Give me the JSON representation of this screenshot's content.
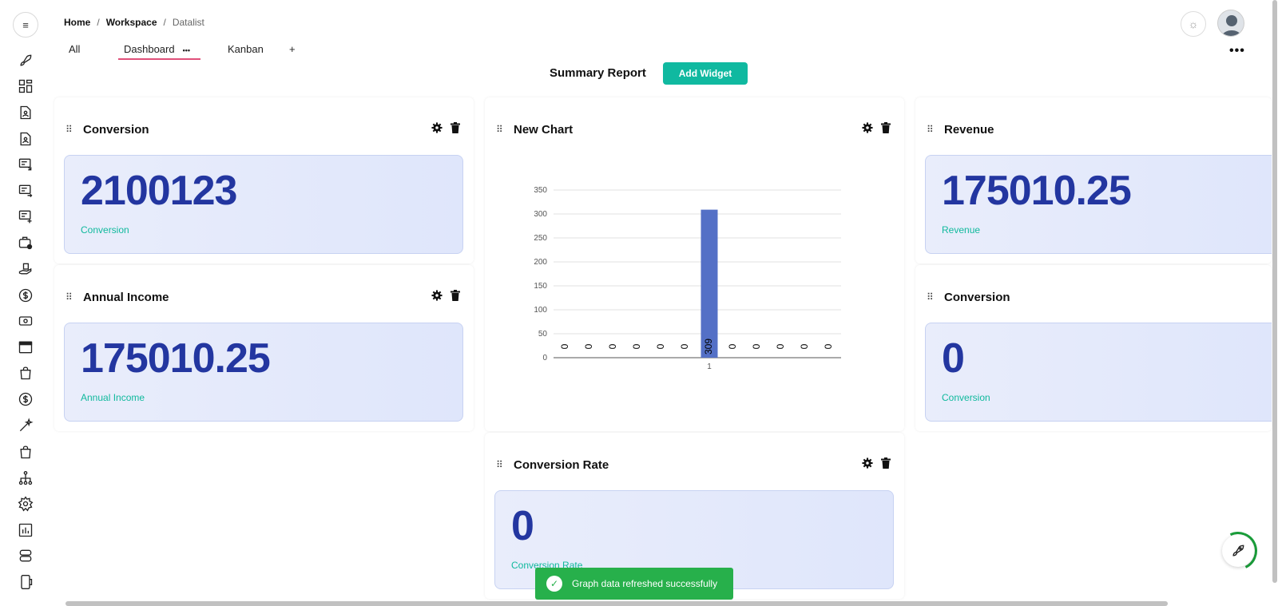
{
  "breadcrumb": {
    "home": "Home",
    "sep1": "/",
    "workspace": "Workspace",
    "sep2": "/",
    "current": "Datalist"
  },
  "tabs": [
    {
      "label": "All"
    },
    {
      "label": "Dashboard",
      "menu": "•••"
    },
    {
      "label": "Kanban"
    },
    {
      "label": "+"
    }
  ],
  "more_menu": "•••",
  "summary": {
    "title": "Summary Report",
    "add_widget": "Add Widget"
  },
  "sidebar": {
    "menu_icon": "≡",
    "items": [
      "rocket-icon",
      "grid-icon",
      "document-user-icon",
      "document-user-icon",
      "list-import-icon",
      "list-export-icon",
      "list-add-icon",
      "briefcase-clock-icon",
      "hand-money-icon",
      "dollar-circle-icon",
      "money-card-icon",
      "calendar-panel-icon",
      "shopping-bag-icon",
      "dollar-circle-icon",
      "magic-wand-icon",
      "shopping-bag-icon",
      "org-chart-icon",
      "settings-icon",
      "bar-report-icon",
      "server-icon",
      "mobile-icon"
    ]
  },
  "widgets": {
    "conversion_top": {
      "title": "Conversion",
      "value": "2100123",
      "label": "Conversion"
    },
    "annual_income": {
      "title": "Annual Income",
      "value": "175010.25",
      "label": "Annual Income"
    },
    "new_chart": {
      "title": "New Chart"
    },
    "revenue": {
      "title": "Revenue",
      "value": "175010.25",
      "label": "Revenue"
    },
    "conversion_right": {
      "title": "Conversion",
      "value": "0",
      "label": "Conversion"
    },
    "conversion_rate": {
      "title": "Conversion Rate",
      "value": "0",
      "label": "Conversion Rate"
    }
  },
  "chart_data": {
    "type": "bar",
    "categories": [
      "",
      "",
      "",
      "",
      "",
      "",
      "1",
      "",
      "",
      "",
      "",
      ""
    ],
    "values": [
      0,
      0,
      0,
      0,
      0,
      0,
      309,
      0,
      0,
      0,
      0,
      0
    ],
    "data_labels": [
      "0",
      "0",
      "0",
      "0",
      "0",
      "0",
      "309",
      "0",
      "0",
      "0",
      "0",
      "0"
    ],
    "ylim": [
      0,
      350
    ],
    "yticks": [
      0,
      50,
      100,
      150,
      200,
      250,
      300,
      350
    ],
    "grid": true,
    "bar_color": "#5470c6"
  },
  "toast": {
    "message": "Graph data refreshed successfully"
  },
  "colors": {
    "accent": "#10b9a0",
    "metric_value": "#2336a0",
    "metric_label": "#10b99d",
    "tab_underline": "#e0507a",
    "toast": "#27b04b"
  }
}
